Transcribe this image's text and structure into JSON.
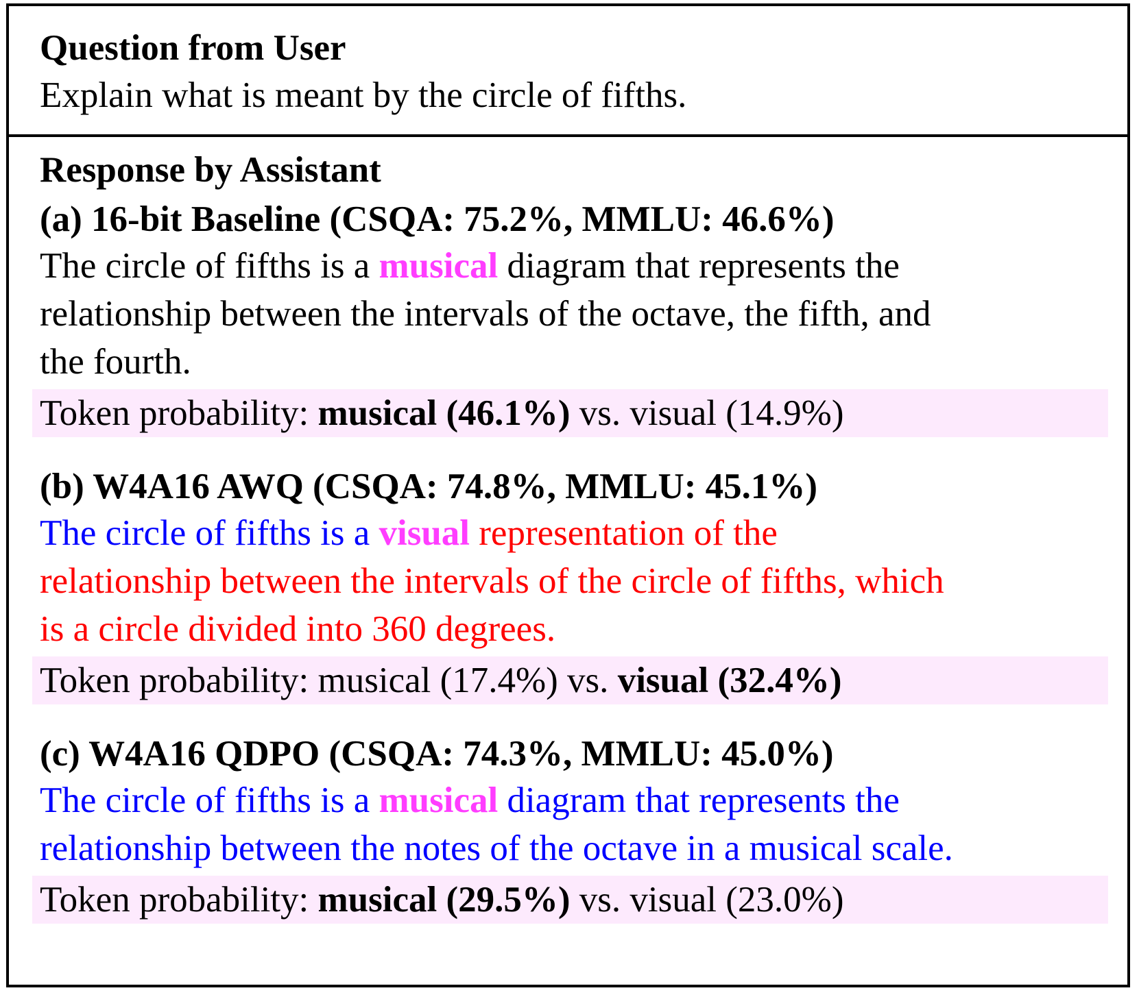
{
  "colors": {
    "highlight_word": "#ff3dff",
    "degraded_text": "#ff0000",
    "preserved_text": "#0000ff",
    "probability_band": "#fdeafd",
    "border": "#000000"
  },
  "question": {
    "heading": "Question from User",
    "text": "Explain what is meant by the circle of fifths."
  },
  "response": {
    "heading": "Response by Assistant",
    "a": {
      "title": "(a) 16-bit Baseline (CSQA: 75.2%, MMLU: 46.6%)",
      "l1_pre": "The circle of fifths is a ",
      "l1_key": "musical",
      "l1_post": " diagram that represents the",
      "l2": "relationship between the intervals of the octave, the fifth, and",
      "l3": "the fourth.",
      "prob_label": "Token probability: ",
      "prob_first": "musical (46.1%)",
      "prob_vs": " vs. ",
      "prob_second": "visual (14.9%)"
    },
    "b": {
      "title": "(b) W4A16 AWQ (CSQA: 74.8%, MMLU: 45.1%)",
      "l1_blue": "The circle of fifths is a ",
      "l1_key": "visual",
      "l1_red": " representation of the",
      "l2": "relationship between the intervals of the circle of fifths, which",
      "l3": "is a circle divided into 360 degrees.",
      "prob_label": "Token probability: ",
      "prob_first": "musical (17.4%)",
      "prob_vs": " vs. ",
      "prob_second": "visual (32.4%)"
    },
    "c": {
      "title": "(c) W4A16 QDPO (CSQA: 74.3%, MMLU: 45.0%)",
      "l1_pre": "The circle of fifths is a ",
      "l1_key": "musical",
      "l1_post": " diagram that represents the",
      "l2": "relationship between the notes of the octave in a musical scale.",
      "prob_label": "Token probability: ",
      "prob_first": "musical (29.5%)",
      "prob_vs": " vs. ",
      "prob_second": "visual (23.0%)"
    }
  }
}
